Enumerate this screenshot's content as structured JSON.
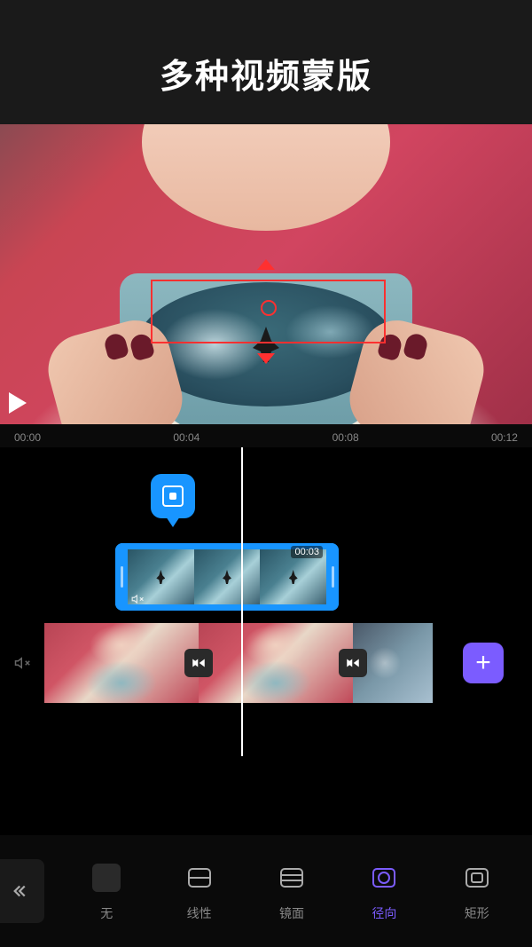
{
  "header": {
    "title": "多种视频蒙版"
  },
  "ruler": {
    "marks": [
      "00:00",
      "00:04",
      "00:08",
      "00:12"
    ]
  },
  "overlay_clip": {
    "duration": "00:03"
  },
  "toolbar": {
    "items": [
      {
        "id": "none",
        "label": "无",
        "active": false
      },
      {
        "id": "linear",
        "label": "线性",
        "active": false
      },
      {
        "id": "mirror",
        "label": "镜面",
        "active": false
      },
      {
        "id": "radial",
        "label": "径向",
        "active": true
      },
      {
        "id": "rect",
        "label": "矩形",
        "active": false
      }
    ]
  },
  "icons": {
    "add": "+",
    "mute": "🔇"
  }
}
